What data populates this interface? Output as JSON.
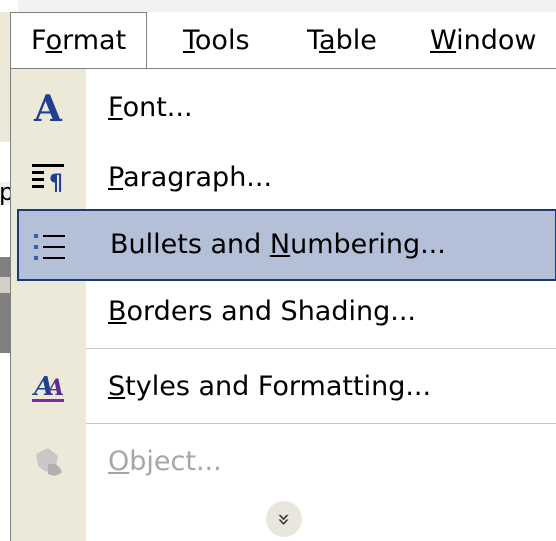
{
  "menubar": {
    "items": [
      {
        "pre": "F",
        "u": "o",
        "post": "rmat"
      },
      {
        "pre": "",
        "u": "T",
        "post": "ools"
      },
      {
        "pre": "T",
        "u": "a",
        "post": "ble"
      },
      {
        "pre": "",
        "u": "W",
        "post": "indow"
      }
    ]
  },
  "background": {
    "fragment": "p"
  },
  "menu": {
    "items": [
      {
        "pre": "",
        "u": "F",
        "post": "ont...",
        "icon": "font-icon",
        "state": "normal"
      },
      {
        "pre": "",
        "u": "P",
        "post": "aragraph...",
        "icon": "paragraph-icon",
        "state": "normal"
      },
      {
        "pre": "Bullets and ",
        "u": "N",
        "post": "umbering...",
        "icon": "bullets-numbering-icon",
        "state": "highlighted"
      },
      {
        "pre": "",
        "u": "B",
        "post": "orders and Shading...",
        "icon": "",
        "state": "normal"
      },
      {
        "pre": "",
        "u": "S",
        "post": "tyles and Formatting...",
        "icon": "styles-formatting-icon",
        "state": "normal"
      },
      {
        "pre": "",
        "u": "O",
        "post": "bject...",
        "icon": "object-icon",
        "state": "disabled"
      }
    ],
    "expand_glyph": "»"
  },
  "colors": {
    "highlight_fill": "#b4bfd8",
    "highlight_border": "#1a3b7a",
    "gutter": "#ece9d8",
    "disabled_text": "#a6a6a6",
    "icon_blue": "#1f3f8f"
  }
}
